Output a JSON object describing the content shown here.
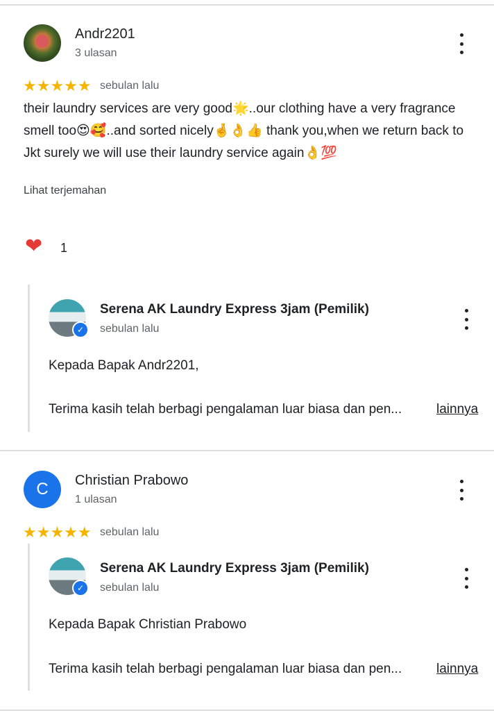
{
  "reviews": [
    {
      "author": "Andr2201",
      "review_count": "3 ulasan",
      "avatar_icon": "profile-photo",
      "stars": "★★★★★",
      "rating": 5,
      "time": "sebulan lalu",
      "text": "their laundry services are very good🌟..our clothing have a very fragrance smell too😍🥰..and sorted nicely🤞👌👍 thank you,when we return back to Jkt surely we will use their laundry service again👌💯",
      "translate_label": "Lihat terjemahan",
      "likes": "1",
      "owner_reply": {
        "name": "Serena AK Laundry Express 3jam (Pemilik)",
        "time": "sebulan lalu",
        "greeting": "Kepada Bapak Andr2201,",
        "snippet": "Terima kasih telah berbagi pengalaman luar biasa dan pen...",
        "more_label": "lainnya"
      }
    },
    {
      "author": "Christian Prabowo",
      "review_count": "1 ulasan",
      "avatar_letter": "C",
      "stars": "★★★★★",
      "rating": 5,
      "time": "sebulan lalu",
      "owner_reply": {
        "name": "Serena AK Laundry Express 3jam (Pemilik)",
        "time": "sebulan lalu",
        "greeting": "Kepada Bapak Christian Prabowo",
        "snippet": "Terima kasih telah berbagi pengalaman luar biasa dan pen...",
        "more_label": "lainnya"
      }
    }
  ],
  "colors": {
    "star": "#f5b400",
    "heart": "#e53935",
    "avatar_blue": "#1a73e8",
    "divider": "#dcdcdc"
  }
}
